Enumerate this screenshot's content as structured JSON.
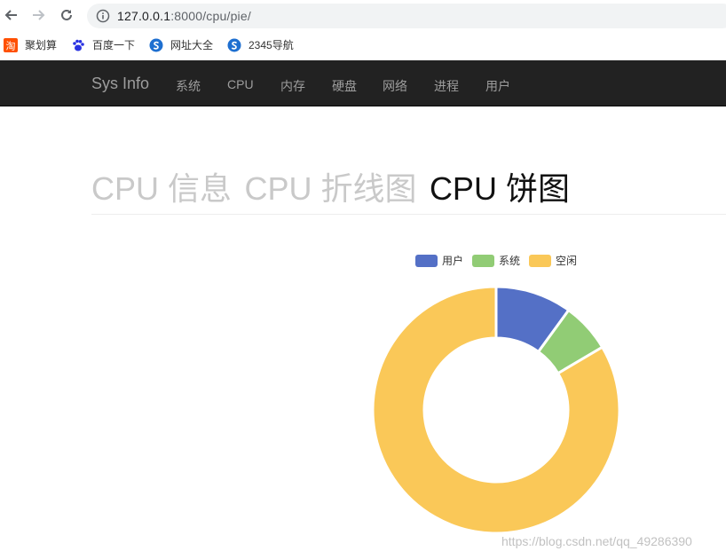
{
  "browser": {
    "url_host": "127.0.0.1",
    "url_rest": ":8000/cpu/pie/",
    "bookmarks": [
      {
        "label": "聚划算",
        "icon": "taobao-icon"
      },
      {
        "label": "百度一下",
        "icon": "baidu-paw-icon"
      },
      {
        "label": "网址大全",
        "icon": "sogou-icon"
      },
      {
        "label": "2345导航",
        "icon": "sogou-icon"
      }
    ]
  },
  "navbar": {
    "brand": "Sys Info",
    "items": [
      "系统",
      "CPU",
      "内存",
      "硬盘",
      "网络",
      "进程",
      "用户"
    ]
  },
  "header": {
    "tabs": [
      {
        "label": "CPU 信息",
        "active": false
      },
      {
        "label": "CPU 折线图",
        "active": false
      },
      {
        "label": "CPU 饼图",
        "active": true
      }
    ]
  },
  "chart_data": {
    "type": "pie",
    "donut": true,
    "labels": [
      "用户",
      "系统",
      "空闲"
    ],
    "values": [
      10,
      6.5,
      83.5
    ],
    "colors": [
      "#5470c6",
      "#91cc75",
      "#fac858"
    ],
    "legend_position": "top"
  },
  "watermark": "https://blog.csdn.net/qq_49286390"
}
